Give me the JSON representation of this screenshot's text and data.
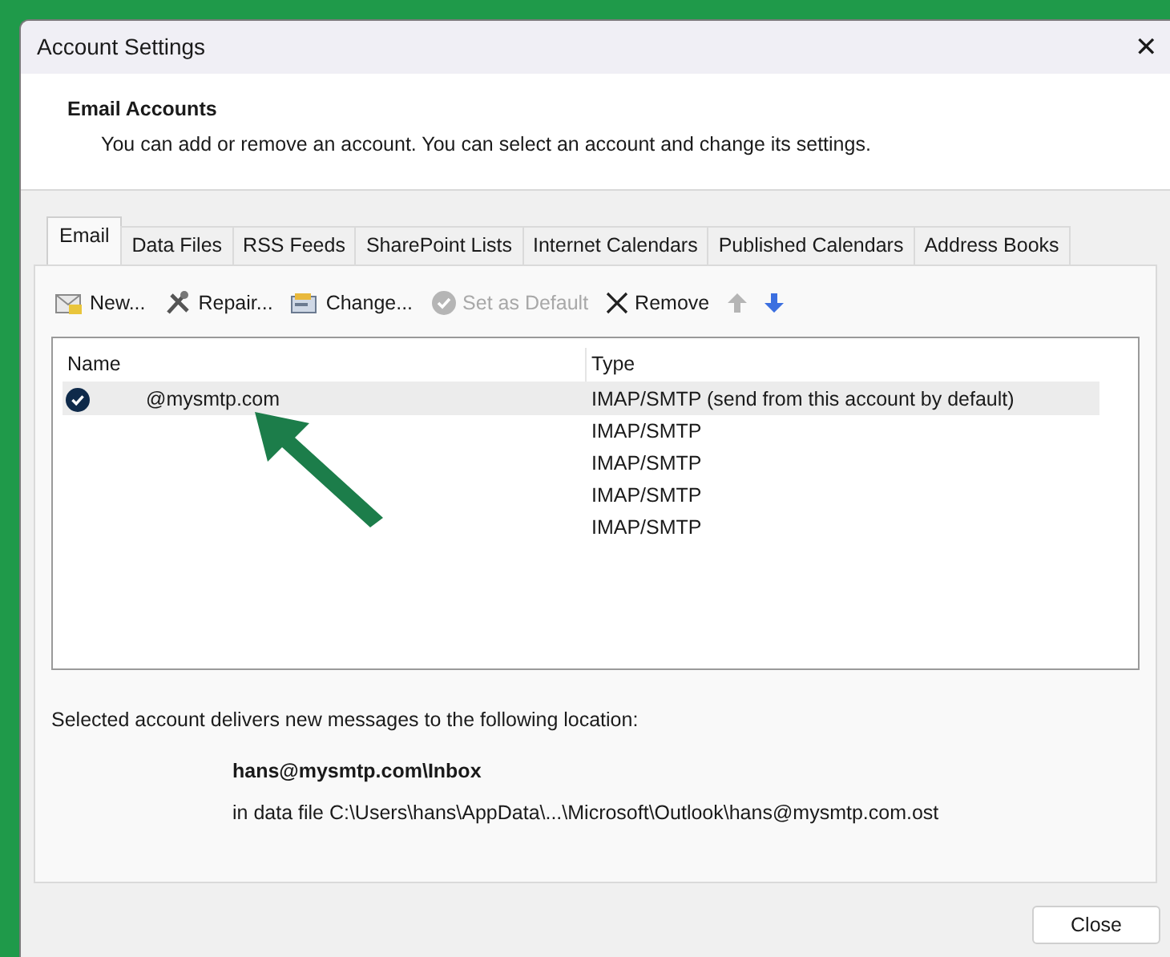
{
  "window": {
    "title": "Account Settings",
    "close": "✕"
  },
  "header": {
    "title": "Email Accounts",
    "description": "You can add or remove an account. You can select an account and change its settings."
  },
  "tabs": [
    {
      "label": "Email",
      "selected": true
    },
    {
      "label": "Data Files",
      "selected": false
    },
    {
      "label": "RSS Feeds",
      "selected": false
    },
    {
      "label": "SharePoint Lists",
      "selected": false
    },
    {
      "label": "Internet Calendars",
      "selected": false
    },
    {
      "label": "Published Calendars",
      "selected": false
    },
    {
      "label": "Address Books",
      "selected": false
    }
  ],
  "toolbar": [
    {
      "kind": "new",
      "label": "New...",
      "disabled": false
    },
    {
      "kind": "repair",
      "label": "Repair...",
      "disabled": false
    },
    {
      "kind": "change",
      "label": "Change...",
      "disabled": false
    },
    {
      "kind": "default",
      "label": "Set as Default",
      "disabled": true
    },
    {
      "kind": "remove",
      "label": "Remove",
      "disabled": false
    },
    {
      "kind": "up",
      "disabled": true
    },
    {
      "kind": "down",
      "disabled": false
    }
  ],
  "table": {
    "columns": [
      "Name",
      "Type"
    ],
    "rows": [
      {
        "name": "@mysmtp.com",
        "type": "IMAP/SMTP (send from this account by default)",
        "selected": true,
        "default": true
      },
      {
        "type": "IMAP/SMTP",
        "selected": false,
        "default": false
      },
      {
        "type": "IMAP/SMTP",
        "selected": false,
        "default": false
      },
      {
        "type": "IMAP/SMTP",
        "selected": false,
        "default": false
      },
      {
        "type": "IMAP/SMTP",
        "selected": false,
        "default": false
      }
    ]
  },
  "location": {
    "intro": "Selected account delivers new messages to the following location:",
    "folder": "hans@mysmtp.com\\Inbox",
    "file": "in data file C:\\Users\\hans\\AppData\\...\\Microsoft\\Outlook\\hans@mysmtp.com.ost"
  },
  "buttons": [
    "Close"
  ]
}
